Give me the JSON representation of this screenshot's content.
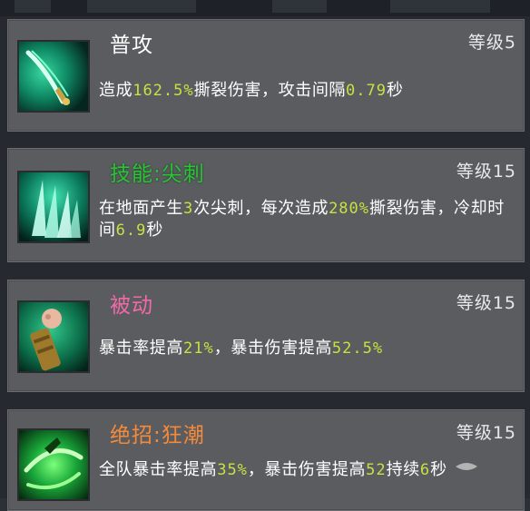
{
  "skills": [
    {
      "name": "普攻",
      "level": "等级5",
      "icon": "dagger-slash-icon",
      "desc": [
        {
          "t": "造成",
          "n": false
        },
        {
          "t": "162.5%",
          "n": true
        },
        {
          "t": "撕裂伤害，攻击间隔",
          "n": false
        },
        {
          "t": "0.79",
          "n": true
        },
        {
          "t": "秒",
          "n": false
        }
      ]
    },
    {
      "name": "技能:尖刺",
      "level": "等级15",
      "icon": "spikes-icon",
      "desc": [
        {
          "t": "在地面产生",
          "n": false
        },
        {
          "t": "3",
          "n": true
        },
        {
          "t": "次尖刺，每次造成",
          "n": false
        },
        {
          "t": "280%",
          "n": true
        },
        {
          "t": "撕裂伤害，冷却时间",
          "n": false
        },
        {
          "t": "6.9",
          "n": true
        },
        {
          "t": "秒",
          "n": false
        }
      ]
    },
    {
      "name": "被动",
      "level": "等级15",
      "icon": "fist-arm-icon",
      "desc": [
        {
          "t": "暴击率提高",
          "n": false
        },
        {
          "t": "21%",
          "n": true
        },
        {
          "t": "，暴击伤害提高",
          "n": false
        },
        {
          "t": "52.5%",
          "n": true
        }
      ]
    },
    {
      "name": "绝招:狂潮",
      "level": "等级15",
      "icon": "whirlwind-icon",
      "desc": [
        {
          "t": "全队暴击率提高",
          "n": false
        },
        {
          "t": "35%",
          "n": true
        },
        {
          "t": "，暴击伤害提高",
          "n": false
        },
        {
          "t": "52",
          "n": true
        },
        {
          "t": "持续",
          "n": false
        },
        {
          "t": "6",
          "n": true
        },
        {
          "t": "秒",
          "n": false
        }
      ]
    }
  ],
  "colors": {
    "number": "#c8e040",
    "name_normal": "#ffffff",
    "name_skill": "#2ec23a",
    "name_passive": "#f06aa8",
    "name_ultimate": "#f48a3a"
  }
}
